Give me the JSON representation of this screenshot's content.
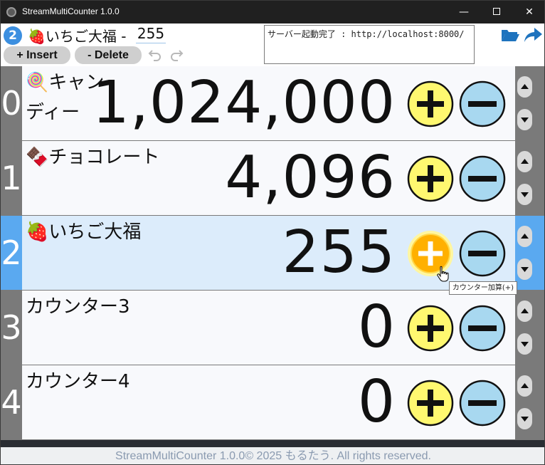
{
  "window": {
    "title": "StreamMultiCounter 1.0.0",
    "minimize": "—",
    "close": "✕"
  },
  "header": {
    "selected_index": "2",
    "selected_icon": "🍓",
    "selected_name": "いちご大福 -",
    "selected_value": "255",
    "insert_label": "+ Insert",
    "delete_label": "- Delete",
    "log_text": "サーバー起動完了 : http://localhost:8000/"
  },
  "counters": [
    {
      "index": "0",
      "icon": "🍭",
      "name": "キャンディー",
      "value": "1,024,000"
    },
    {
      "index": "1",
      "icon": "🍫",
      "name": "チョコレート",
      "value": "4,096"
    },
    {
      "index": "2",
      "icon": "🍓",
      "name": "いちご大福",
      "value": "255"
    },
    {
      "index": "3",
      "icon": "",
      "name": "カウンター3",
      "value": "0"
    },
    {
      "index": "4",
      "icon": "",
      "name": "カウンター4",
      "value": "0"
    }
  ],
  "tooltip": "カウンター加算(+)",
  "footer": "StreamMultiCounter 1.0.0© 2025 もるたう. All rights reserved.",
  "colors": {
    "accent": "#5aa9f0",
    "plus_button": "#fff870",
    "plus_button_hover": "#ffb000",
    "minus_button": "#a8d8f0",
    "selected_row": "#dcecfb"
  }
}
